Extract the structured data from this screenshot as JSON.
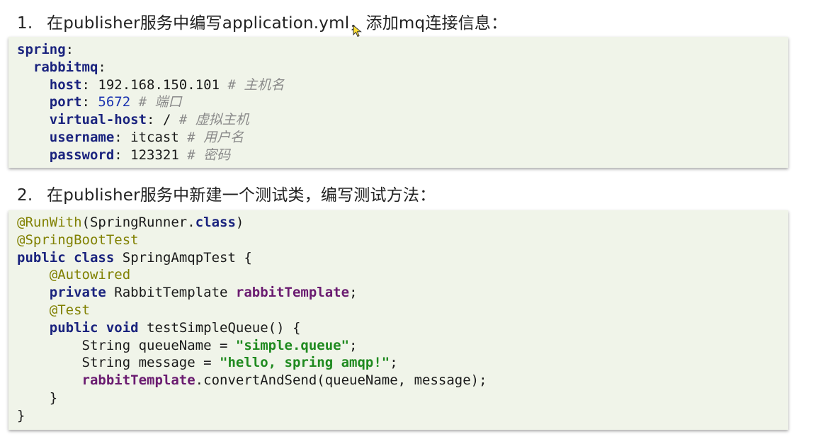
{
  "steps": [
    {
      "number": "1.",
      "text": "在publisher服务中编写application.yml，添加mq连接信息："
    },
    {
      "number": "2.",
      "text": "在publisher服务中新建一个测试类，编写测试方法："
    }
  ],
  "yaml": {
    "spring": "spring",
    "rabbitmq": "rabbitmq",
    "host_key": "host",
    "host_value": "192.168.150.101",
    "host_comment": "# 主机名",
    "port_key": "port",
    "port_value": "5672",
    "port_comment": "# 端口",
    "vhost_key": "virtual-host",
    "vhost_value": "/",
    "vhost_comment": "# 虚拟主机",
    "username_key": "username",
    "username_value": "itcast",
    "username_comment": "# 用户名",
    "password_key": "password",
    "password_value": "123321",
    "password_comment": "# 密码"
  },
  "java": {
    "ann_runwith": "@RunWith",
    "runwith_arg": "SpringRunner",
    "class_kw": "class",
    "ann_boottest": "@SpringBootTest",
    "public_kw": "public",
    "class_name": "SpringAmqpTest",
    "ann_autowired": "@Autowired",
    "private_kw": "private",
    "type_rabbit": "RabbitTemplate",
    "field_name": "rabbitTemplate",
    "ann_test": "@Test",
    "void_kw": "void",
    "method_name": "testSimpleQueue",
    "string_type": "String",
    "var_queue": "queueName",
    "str_queue": "\"simple.queue\"",
    "var_message": "message",
    "str_message": "\"hello, spring amqp!\"",
    "call_method": "convertAndSend",
    "call_args": "queueName, message"
  }
}
